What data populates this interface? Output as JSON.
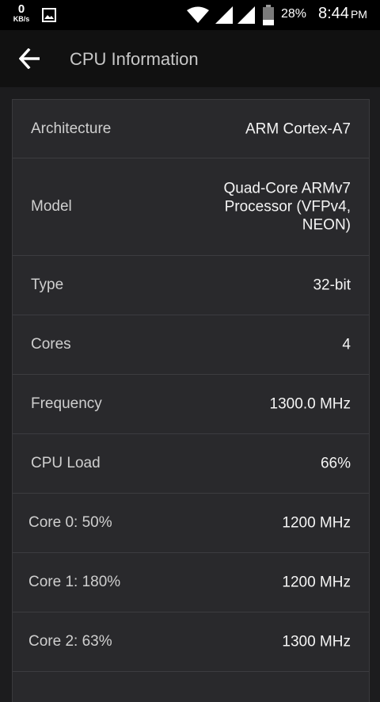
{
  "status_bar": {
    "net_speed_value": "0",
    "net_speed_unit": "KB/s",
    "battery_percent": "28%",
    "time": "8:44",
    "ampm": "PM",
    "icons": [
      "gallery-icon",
      "wifi-icon",
      "signal-icon",
      "signal-icon",
      "battery-icon"
    ]
  },
  "app_bar": {
    "back_icon": "arrow-left-icon",
    "title": "CPU Information"
  },
  "info_rows": [
    {
      "label": "Architecture",
      "value": "ARM Cortex-A7"
    },
    {
      "label": "Model",
      "value": "Quad-Core ARMv7 Processor (VFPv4, NEON)"
    },
    {
      "label": "Type",
      "value": "32-bit"
    },
    {
      "label": "Cores",
      "value": "4"
    },
    {
      "label": "Frequency",
      "value": "1300.0 MHz"
    },
    {
      "label": "CPU Load",
      "value": "66%"
    }
  ],
  "core_rows": [
    {
      "label": "Core 0: 50%",
      "value": "1200 MHz"
    },
    {
      "label": "Core 1: 180%",
      "value": "1200 MHz"
    },
    {
      "label": "Core 2: 63%",
      "value": "1300 MHz"
    }
  ],
  "colors": {
    "status_bar": "#000000",
    "app_bar": "#111111",
    "card": "#29292c",
    "divider": "#3c3c40"
  }
}
